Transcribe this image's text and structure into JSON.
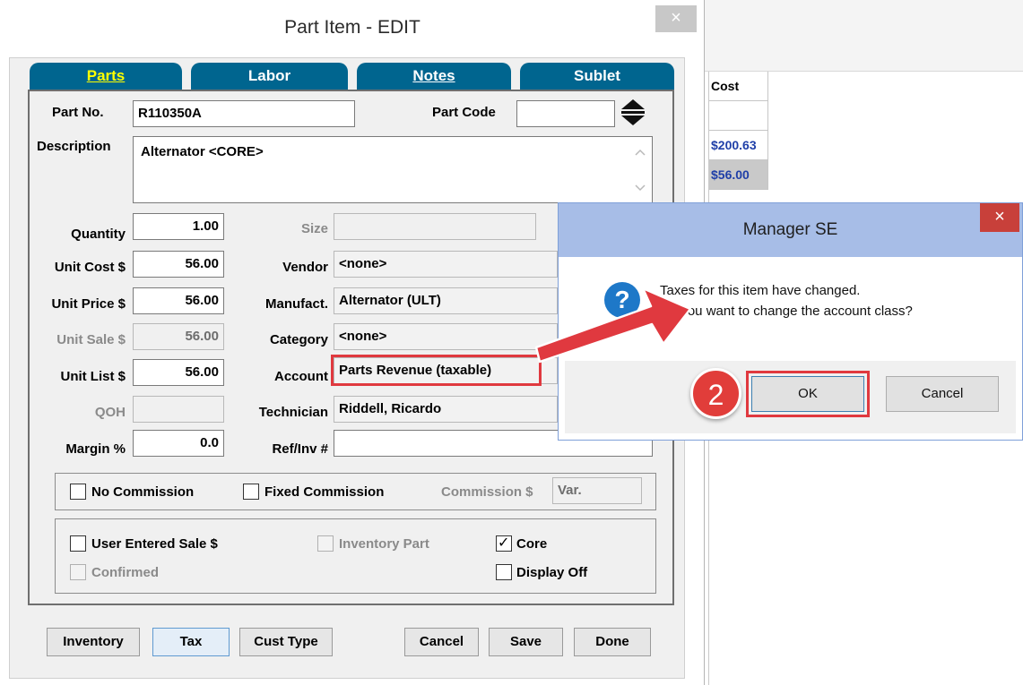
{
  "main_dialog": {
    "title": "Part Item - EDIT",
    "close_glyph": "×",
    "tabs": [
      {
        "label": "Parts",
        "active": true
      },
      {
        "label": "Labor",
        "active": false
      },
      {
        "label": "Notes",
        "active": false
      },
      {
        "label": "Sublet",
        "active": false
      }
    ],
    "fields": {
      "part_no_label": "Part No.",
      "part_no": "R110350A",
      "part_code_label": "Part Code",
      "part_code": "",
      "description_label": "Description",
      "description": "Alternator <CORE>",
      "quantity_label": "Quantity",
      "quantity": "1.00",
      "size_label": "Size",
      "size": "",
      "unit_cost_label": "Unit Cost $",
      "unit_cost": "56.00",
      "vendor_label": "Vendor",
      "vendor": "<none>",
      "unit_price_label": "Unit Price $",
      "unit_price": "56.00",
      "manufact_label": "Manufact.",
      "manufact": "Alternator (ULT)",
      "unit_sale_label": "Unit Sale $",
      "unit_sale": "56.00",
      "category_label": "Category",
      "category": "<none>",
      "unit_list_label": "Unit List $",
      "unit_list": "56.00",
      "account_label": "Account",
      "account": "Parts Revenue (taxable)",
      "qoh_label": "QOH",
      "qoh": "",
      "technician_label": "Technician",
      "technician": "Riddell, Ricardo",
      "margin_label": "Margin %",
      "margin": "0.0",
      "ref_inv_label": "Ref/Inv #",
      "ref_inv": ""
    },
    "commission": {
      "no_commission": "No Commission",
      "fixed_commission": "Fixed Commission",
      "commission_label": "Commission $",
      "commission_value": "Var."
    },
    "flags": {
      "user_entered_sale": "User Entered Sale $",
      "inventory_part": "Inventory Part",
      "core": "Core",
      "core_checked": true,
      "confirmed": "Confirmed",
      "display_off": "Display Off"
    },
    "buttons": {
      "inventory": "Inventory",
      "tax": "Tax",
      "cust_type": "Cust Type",
      "cancel": "Cancel",
      "save": "Save",
      "done": "Done"
    }
  },
  "background_list": {
    "cost_header": "Cost",
    "cost_rows": [
      "",
      "$200.63",
      "$56.00"
    ]
  },
  "message_box": {
    "title": "Manager SE",
    "close_glyph": "×",
    "icon": "question-icon",
    "line1": "Taxes for this item have changed.",
    "line2": "Do you want to change the account class?",
    "ok": "OK",
    "cancel": "Cancel"
  },
  "annotation": {
    "step_number": "2"
  },
  "colors": {
    "tab_blue": "#00658f",
    "tab_active_text": "#ffff00",
    "highlight_red": "#e0393f",
    "msg_title_bg": "#a7bde7",
    "link_blue": "#1f3fa8"
  }
}
